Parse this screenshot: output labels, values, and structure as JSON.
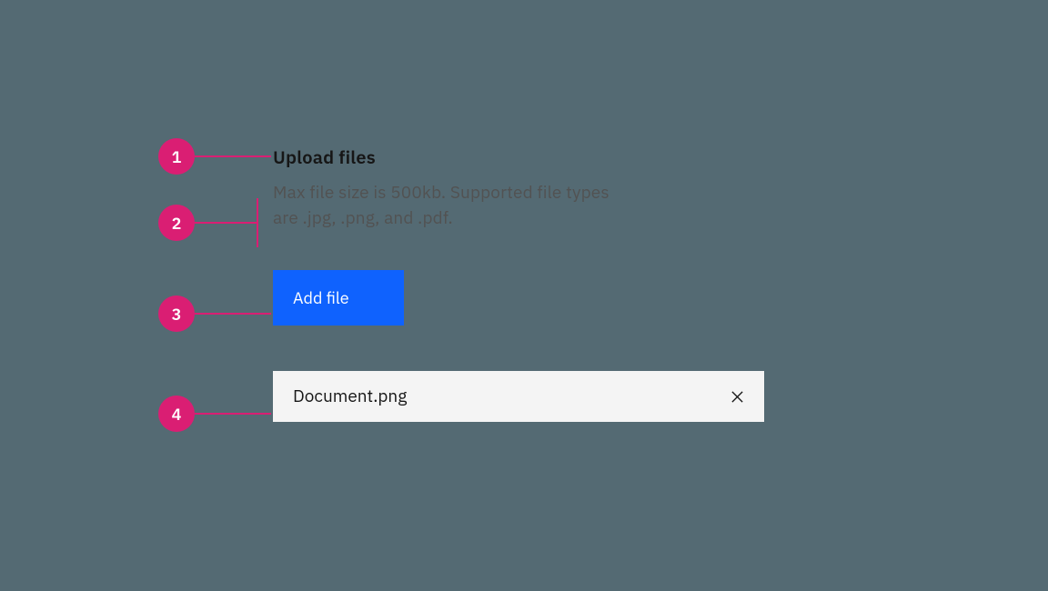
{
  "annotations": {
    "n1": "1",
    "n2": "2",
    "n3": "3",
    "n4": "4"
  },
  "uploader": {
    "heading": "Upload files",
    "description": "Max file size is 500kb. Supported file types are .jpg, .png, and .pdf.",
    "button_label": "Add file",
    "file_name": "Document.png"
  }
}
